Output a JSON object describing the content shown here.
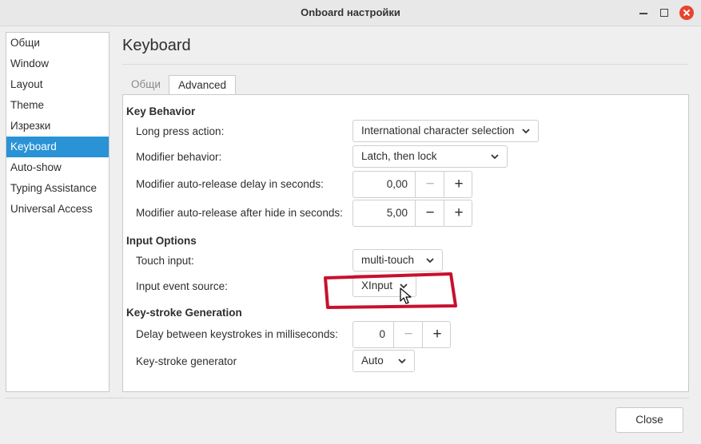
{
  "window": {
    "title": "Onboard настройки"
  },
  "sidebar": {
    "items": [
      {
        "label": "Общи"
      },
      {
        "label": "Window"
      },
      {
        "label": "Layout"
      },
      {
        "label": "Theme"
      },
      {
        "label": "Изрезки"
      },
      {
        "label": "Keyboard",
        "selected": true
      },
      {
        "label": "Auto-show"
      },
      {
        "label": "Typing Assistance"
      },
      {
        "label": "Universal Access"
      }
    ]
  },
  "page": {
    "title": "Keyboard",
    "tabs": [
      {
        "label": "Общи"
      },
      {
        "label": "Advanced",
        "active": true
      }
    ]
  },
  "key_behavior": {
    "header": "Key Behavior",
    "long_press_label": "Long press action:",
    "long_press_value": "International character selection",
    "modifier_behavior_label": "Modifier behavior:",
    "modifier_behavior_value": "Latch, then lock",
    "release_delay_label": "Modifier auto-release delay in seconds:",
    "release_delay_value": "0,00",
    "release_after_hide_label": "Modifier auto-release after hide in seconds:",
    "release_after_hide_value": "5,00"
  },
  "input_options": {
    "header": "Input Options",
    "touch_input_label": "Touch input:",
    "touch_input_value": "multi-touch",
    "event_source_label": "Input event source:",
    "event_source_value": "XInput"
  },
  "keystroke": {
    "header": "Key-stroke Generation",
    "delay_label": "Delay between keystrokes in milliseconds:",
    "delay_value": "0",
    "generator_label": "Key-stroke generator",
    "generator_value": "Auto"
  },
  "spin": {
    "minus": "−",
    "plus": "+"
  },
  "footer": {
    "close_label": "Close"
  },
  "colors": {
    "selection": "#2a93d5",
    "annotation": "#c8102e",
    "close_button_bg": "#e8432f"
  }
}
